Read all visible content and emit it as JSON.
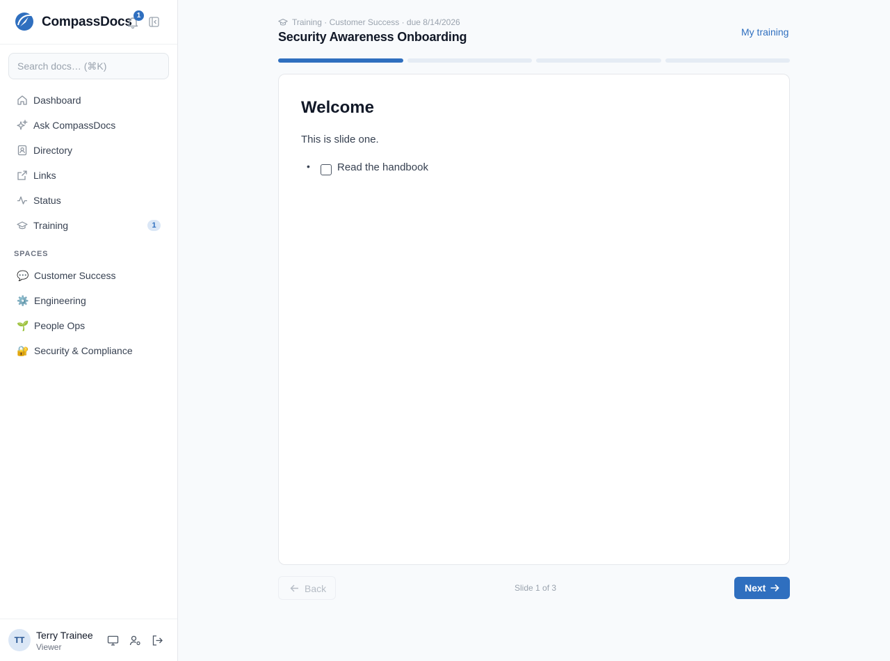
{
  "app": {
    "name": "CompassDocs",
    "notification_count": "1"
  },
  "search": {
    "placeholder": "Search docs… (⌘K)"
  },
  "nav": [
    {
      "label": "Dashboard",
      "icon": "home-icon"
    },
    {
      "label": "Ask CompassDocs",
      "icon": "sparkles-icon"
    },
    {
      "label": "Directory",
      "icon": "contact-book-icon"
    },
    {
      "label": "Links",
      "icon": "external-link-icon"
    },
    {
      "label": "Status",
      "icon": "activity-icon"
    },
    {
      "label": "Training",
      "icon": "graduation-cap-icon",
      "badge": "1"
    }
  ],
  "spaces": {
    "label": "SPACES",
    "items": [
      {
        "emoji": "💬",
        "label": "Customer Success"
      },
      {
        "emoji": "⚙️",
        "label": "Engineering"
      },
      {
        "emoji": "🌱",
        "label": "People Ops"
      },
      {
        "emoji": "🔐",
        "label": "Security & Compliance"
      }
    ]
  },
  "user": {
    "initials": "TT",
    "name": "Terry Trainee",
    "role": "Viewer"
  },
  "header": {
    "breadcrumb": "Training · Customer Success  · due 8/14/2026",
    "title": "Security Awareness Onboarding",
    "my_training": "My training"
  },
  "progress": {
    "current": 1,
    "total": 4
  },
  "slide": {
    "title": "Welcome",
    "text": "This is slide one.",
    "checklist": [
      {
        "label": "Read the handbook",
        "checked": false
      }
    ]
  },
  "footer": {
    "back": "Back",
    "counter": "Slide 1 of 3",
    "next": "Next"
  },
  "colors": {
    "accent": "#2f6fbf",
    "progress_inactive": "#e5ecf4"
  }
}
